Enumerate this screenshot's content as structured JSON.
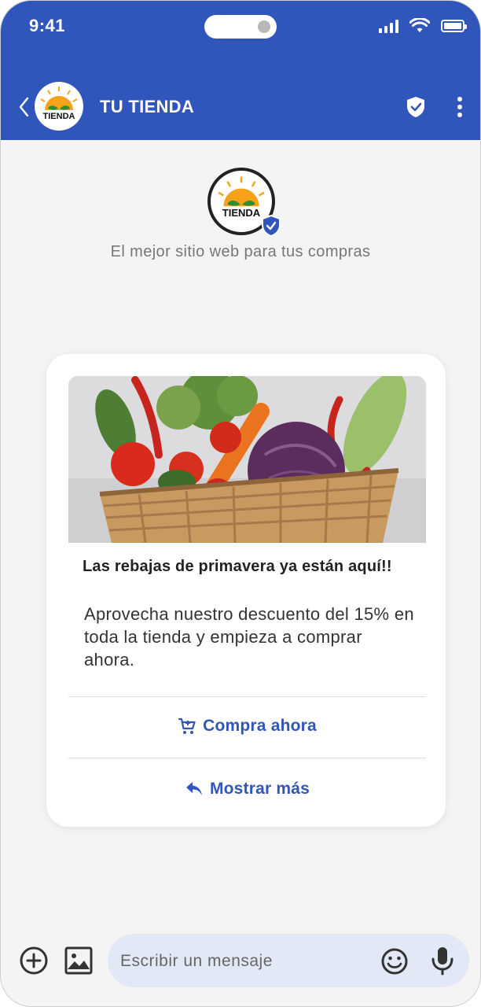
{
  "status_bar": {
    "time": "9:41"
  },
  "header": {
    "title": "TU TIENDA",
    "logo_text": "TIENDA",
    "back_icon": "chevron-left-icon",
    "shield_icon": "shield-check-icon",
    "more_icon": "more-vertical-icon"
  },
  "profile": {
    "logo_text": "TIENDA",
    "verified_icon": "verified-shield-icon",
    "tagline": "El mejor sitio web para tus compras"
  },
  "card": {
    "image_alt": "vegetable-basket",
    "title": "Las rebajas de primavera ya están aquí!!",
    "description": "Aprovecha nuestro descuento del 15% en toda la tienda y empieza a comprar ahora.",
    "actions": [
      {
        "label": "Compra ahora",
        "icon": "cart-icon"
      },
      {
        "label": "Mostrar más",
        "icon": "reply-icon"
      }
    ]
  },
  "composer": {
    "placeholder": "Escribir un mensaje",
    "value": "",
    "add_icon": "plus-circle-icon",
    "gallery_icon": "image-icon",
    "emoji_icon": "emoji-icon",
    "mic_icon": "microphone-icon"
  },
  "colors": {
    "brand": "#3156bb",
    "background": "#f4f4f4",
    "composer": "#e2e8f5"
  }
}
